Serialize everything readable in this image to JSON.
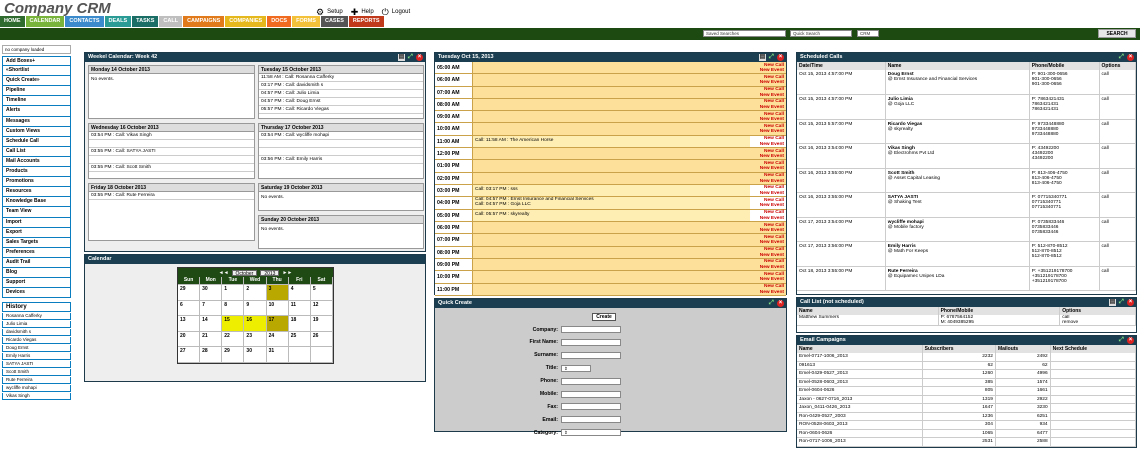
{
  "app": {
    "title": "Company CRM"
  },
  "top_links": [
    {
      "icon": "gears-icon",
      "label": "Setup"
    },
    {
      "icon": "help-icon",
      "label": "Help"
    },
    {
      "icon": "logout-icon",
      "label": "Logout"
    }
  ],
  "nav": [
    {
      "label": "HOME",
      "color": "#2f6b2f"
    },
    {
      "label": "CALENDAR",
      "color": "#78b33c"
    },
    {
      "label": "CONTACTS",
      "color": "#3b8bcc"
    },
    {
      "label": "DEALS",
      "color": "#2b9b95"
    },
    {
      "label": "TASKS",
      "color": "#1a6e66"
    },
    {
      "label": "CALL",
      "color": "#bfbfbf"
    },
    {
      "label": "CAMPAIGNS",
      "color": "#e07a1a"
    },
    {
      "label": "COMPANIES",
      "color": "#e5b91d"
    },
    {
      "label": "DOCS",
      "color": "#f06a20"
    },
    {
      "label": "FORMS",
      "color": "#f4c23a"
    },
    {
      "label": "CASES",
      "color": "#555555"
    },
    {
      "label": "REPORTS",
      "color": "#c0391b"
    }
  ],
  "toolbar": {
    "saved_searches": "Saved Searches",
    "quick_search": "Quick Search",
    "crm_select": "CRM",
    "search_button": "SEARCH"
  },
  "sidebar": {
    "note": "no company loaded",
    "items": [
      "Add Boxes+",
      "«Shortlist",
      "Quick Create»",
      "Pipeline",
      "Timeline",
      "Alerts",
      "Messages",
      "Custom Views",
      "Schedule Call",
      "Call List",
      "Mail Accounts",
      "Products",
      "Promotions",
      "Resources",
      "Knowledge Base",
      "Team View",
      "Import",
      "Export",
      "Sales Targets",
      "Preferences",
      "Audit Trail",
      "Blog",
      "Support",
      "Devices"
    ],
    "history_title": "History",
    "history": [
      "Rosanna Cafferky",
      "Julio Limia",
      "davidsmith s",
      "Ricardo Viegas",
      "Doug Ernst",
      "Emily Harris",
      "SATYA JASTI",
      "Scott Smith",
      "Rute Ferreira",
      "wycliffe mohapi",
      "Vikas Singh"
    ]
  },
  "week": {
    "title": "Weekel Calendar: Week 42",
    "days": [
      {
        "label": "Monday 14 October 2013",
        "events": [],
        "empty": "No events."
      },
      {
        "label": "Tuesday 15 October 2013",
        "events": [
          "11:58 AM : Call: Rosanna Cafferky",
          "03:17 PM : Call: davidsmith s",
          "04:57 PM : Call: Julio Limia",
          "04:57 PM : Call: Doug Ernst",
          "05:57 PM : Call: Ricardo Viegas"
        ]
      },
      {
        "label": "Wednesday 16 October 2013",
        "events": [
          "03:54 PM : Call: Vikas Singh",
          "",
          "03:55 PM : Call: SATYA JASTI",
          "",
          "03:55 PM : Call: Scott Smith"
        ]
      },
      {
        "label": "Thursday 17 October 2013",
        "events": [
          "03:54 PM : Call: wycliffe mohapi",
          "",
          "",
          "03:56 PM : Call: Emily Harris"
        ]
      },
      {
        "label": "Friday 18 October 2013",
        "events": [
          "03:55 PM : Call: Rute Ferreira"
        ]
      },
      {
        "label": "Saturday 19 October 2013",
        "events": [],
        "empty": "No events."
      },
      {
        "label": "Sunday 20 October 2013",
        "events": [],
        "empty": "No events."
      }
    ]
  },
  "calendar": {
    "title": "Calendar",
    "prev": "◄◄",
    "month": "October",
    "year": "2013",
    "next": "►►",
    "weekdays": [
      "Sun",
      "Mon",
      "Tue",
      "Wed",
      "Thu",
      "Fri",
      "Sat"
    ],
    "days": [
      "29",
      "30",
      "1",
      "2",
      "3",
      "4",
      "5",
      "6",
      "7",
      "8",
      "9",
      "10",
      "11",
      "12",
      "13",
      "14",
      "15",
      "16",
      "17",
      "18",
      "19",
      "20",
      "21",
      "22",
      "23",
      "24",
      "25",
      "26",
      "27",
      "28",
      "29",
      "30",
      "31",
      "",
      ""
    ]
  },
  "day": {
    "title": "Tuesday Oct 15, 2013",
    "new_call": "New Call",
    "new_event": "New Event",
    "slots": [
      {
        "time": "05:00 AM",
        "events": []
      },
      {
        "time": "06:00 AM",
        "events": []
      },
      {
        "time": "07:00 AM",
        "events": []
      },
      {
        "time": "08:00 AM",
        "events": []
      },
      {
        "time": "09:00 AM",
        "events": []
      },
      {
        "time": "10:00 AM",
        "events": []
      },
      {
        "time": "11:00 AM",
        "events": [
          "Call: 11:58 AM : The American Horse"
        ]
      },
      {
        "time": "12:00 PM",
        "events": []
      },
      {
        "time": "01:00 PM",
        "events": []
      },
      {
        "time": "02:00 PM",
        "events": []
      },
      {
        "time": "03:00 PM",
        "events": [
          "Call: 03:17 PM : sss"
        ]
      },
      {
        "time": "04:00 PM",
        "events": [
          "Call: 04:57 PM : Ernst Insurance and Financial Services",
          "Call: 04:57 PM : Goja LLC"
        ]
      },
      {
        "time": "05:00 PM",
        "events": [
          "Call: 05:57 PM : skyrealty"
        ]
      },
      {
        "time": "06:00 PM",
        "events": []
      },
      {
        "time": "07:00 PM",
        "events": []
      },
      {
        "time": "08:00 PM",
        "events": []
      },
      {
        "time": "09:00 PM",
        "events": []
      },
      {
        "time": "10:00 PM",
        "events": []
      },
      {
        "time": "11:00 PM",
        "events": []
      }
    ]
  },
  "quick_create": {
    "title": "Quick Create",
    "button": "Create",
    "fields": [
      "Company:",
      "First Name:",
      "Surname:",
      "Title:",
      "Phone:",
      "Mobile:",
      "Fax:",
      "Email:",
      "Category:"
    ]
  },
  "scheduled": {
    "title": "Scheduled Calls",
    "headers": [
      "Date/Time",
      "Name",
      "Phone/Mobile",
      "Options"
    ],
    "rows": [
      [
        "Oct 15, 2013 4:57:00 PM",
        "Doug Ernst|@ Ernst Insurance and Financial Services",
        "P: 901-300-0656|901-300-0656|901-300-0656",
        "call"
      ],
      [
        "Oct 15, 2013 4:57:00 PM",
        "Julio Limia|@ Goja LLC",
        "P: 7863421431|7863421431|7863421431",
        "call"
      ],
      [
        "Oct 15, 2013 5:57:00 PM",
        "Ricardo Viegas|@ skyrealty",
        "P: 9733448880|9733448880|9733448880",
        "call"
      ],
      [
        "Oct 16, 2013 3:54:00 PM",
        "Vikas Singh|@ Electrohms Pvt Ltd",
        "P: 43492200|43492200|43492200",
        "call"
      ],
      [
        "Oct 16, 2013 3:55:00 PM",
        "Scott Smith|@ Asset Capital Leasing",
        "P: 813-406-4750|813-406-4750|813-406-4750",
        "call"
      ],
      [
        "Oct 16, 2013 3:55:00 PM",
        "SATYA JASTI|@ Shaking Tent",
        "P: 07715340771|07715340771|07715340771",
        "call"
      ],
      [
        "Oct 17, 2013 3:54:00 PM",
        "wycliffe mohapi|@ Mobile factory",
        "P: 0735833446|0735833446|0735833446",
        "call"
      ],
      [
        "Oct 17, 2013 3:56:00 PM",
        "Emily Harris|@ Math For Keeps",
        "P: 512-870-8512|512-870-8512|512-870-8512",
        "call"
      ],
      [
        "Oct 18, 2013 3:55:00 PM",
        "Rute Ferreira|@ Equipamec Unipes LDa",
        "P: +351219178700|+351219178700|+351219178700",
        "call"
      ]
    ]
  },
  "call_list": {
    "title": "Call List (not scheduled)",
    "headers": [
      "Name",
      "Phone/Mobile",
      "Options"
    ],
    "rows": [
      [
        "Matthew Summers",
        "P: 6787564152|M: 4049385295",
        "call | remove"
      ]
    ]
  },
  "email": {
    "title": "Email Campaigns",
    "headers": [
      "Name",
      "Subscribers",
      "Mailouts",
      "Next Schedule"
    ],
    "rows": [
      [
        "Emel-0717-1006_2013",
        "2232",
        "2492",
        ""
      ],
      [
        "091613",
        "62",
        "62",
        ""
      ],
      [
        "Emel-0429-0527_2013",
        "1260",
        "4996",
        ""
      ],
      [
        "Emel-0528-0603_2013",
        "385",
        "1574",
        ""
      ],
      [
        "Emel-0604-0626",
        "805",
        "1661",
        ""
      ],
      [
        "Jaxon - 0627-0716_2013",
        "1319",
        "2922",
        ""
      ],
      [
        "Jaxon_0411-0426_2013",
        "1647",
        "3230",
        ""
      ],
      [
        "Ron-0429-0527_2003",
        "1236",
        "6251",
        ""
      ],
      [
        "RON-0528-0603_2013",
        "304",
        "934",
        ""
      ],
      [
        "Ron-0604-0626",
        "1065",
        "6477",
        ""
      ],
      [
        "Ron-0717-1006_2013",
        "2531",
        "2588",
        ""
      ]
    ]
  }
}
